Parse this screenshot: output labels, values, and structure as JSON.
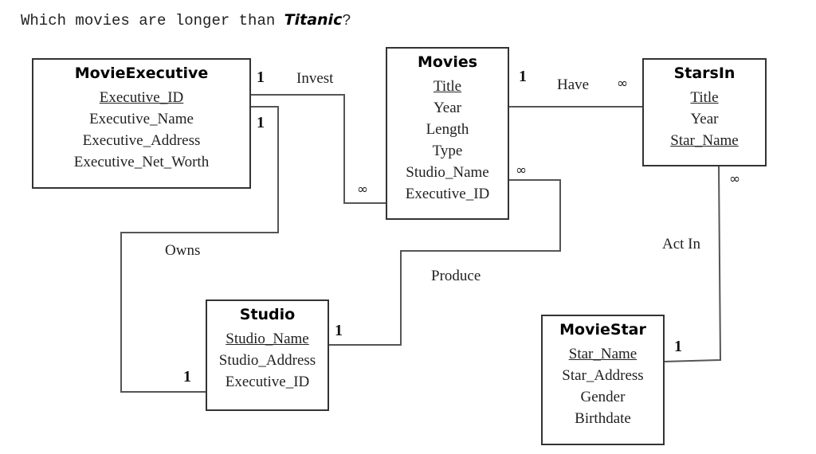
{
  "question": {
    "prefix": "Which movies are longer than ",
    "emphasis": "Titanic",
    "suffix": "?"
  },
  "entities": {
    "movie_executive": {
      "name": "MovieExecutive",
      "attributes": [
        {
          "text": "Executive_ID",
          "key": true
        },
        {
          "text": "Executive_Name",
          "key": false
        },
        {
          "text": "Executive_Address",
          "key": false
        },
        {
          "text": "Executive_Net_Worth",
          "key": false
        }
      ]
    },
    "movies": {
      "name": "Movies",
      "attributes": [
        {
          "text": "Title",
          "key": true
        },
        {
          "text": "Year",
          "key": false
        },
        {
          "text": "Length",
          "key": false
        },
        {
          "text": "Type",
          "key": false
        },
        {
          "text": "Studio_Name",
          "key": false
        },
        {
          "text": "Executive_ID",
          "key": false
        }
      ]
    },
    "stars_in": {
      "name": "StarsIn",
      "attributes": [
        {
          "text": "Title",
          "key": true
        },
        {
          "text": "Year",
          "key": false
        },
        {
          "text": "Star_Name",
          "key": true
        }
      ]
    },
    "studio": {
      "name": "Studio",
      "attributes": [
        {
          "text": "Studio_Name",
          "key": true
        },
        {
          "text": "Studio_Address",
          "key": false
        },
        {
          "text": "Executive_ID",
          "key": false
        }
      ]
    },
    "movie_star": {
      "name": "MovieStar",
      "attributes": [
        {
          "text": "Star_Name",
          "key": true
        },
        {
          "text": "Star_Address",
          "key": false
        },
        {
          "text": "Gender",
          "key": false
        },
        {
          "text": "Birthdate",
          "key": false
        }
      ]
    }
  },
  "relationships": {
    "invest": {
      "label": "Invest",
      "from": "MovieExecutive",
      "to": "Movies",
      "from_card": "1",
      "to_card": "∞"
    },
    "owns": {
      "label": "Owns",
      "from": "MovieExecutive",
      "to": "Studio",
      "from_card": "1",
      "to_card": "1"
    },
    "have": {
      "label": "Have",
      "from": "Movies",
      "to": "StarsIn",
      "from_card": "1",
      "to_card": "∞"
    },
    "produce": {
      "label": "Produce",
      "from": "Studio",
      "to": "Movies",
      "from_card": "1",
      "to_card": "∞"
    },
    "act_in": {
      "label": "Act In",
      "from": "MovieStar",
      "to": "StarsIn",
      "from_card": "1",
      "to_card": "∞"
    }
  }
}
